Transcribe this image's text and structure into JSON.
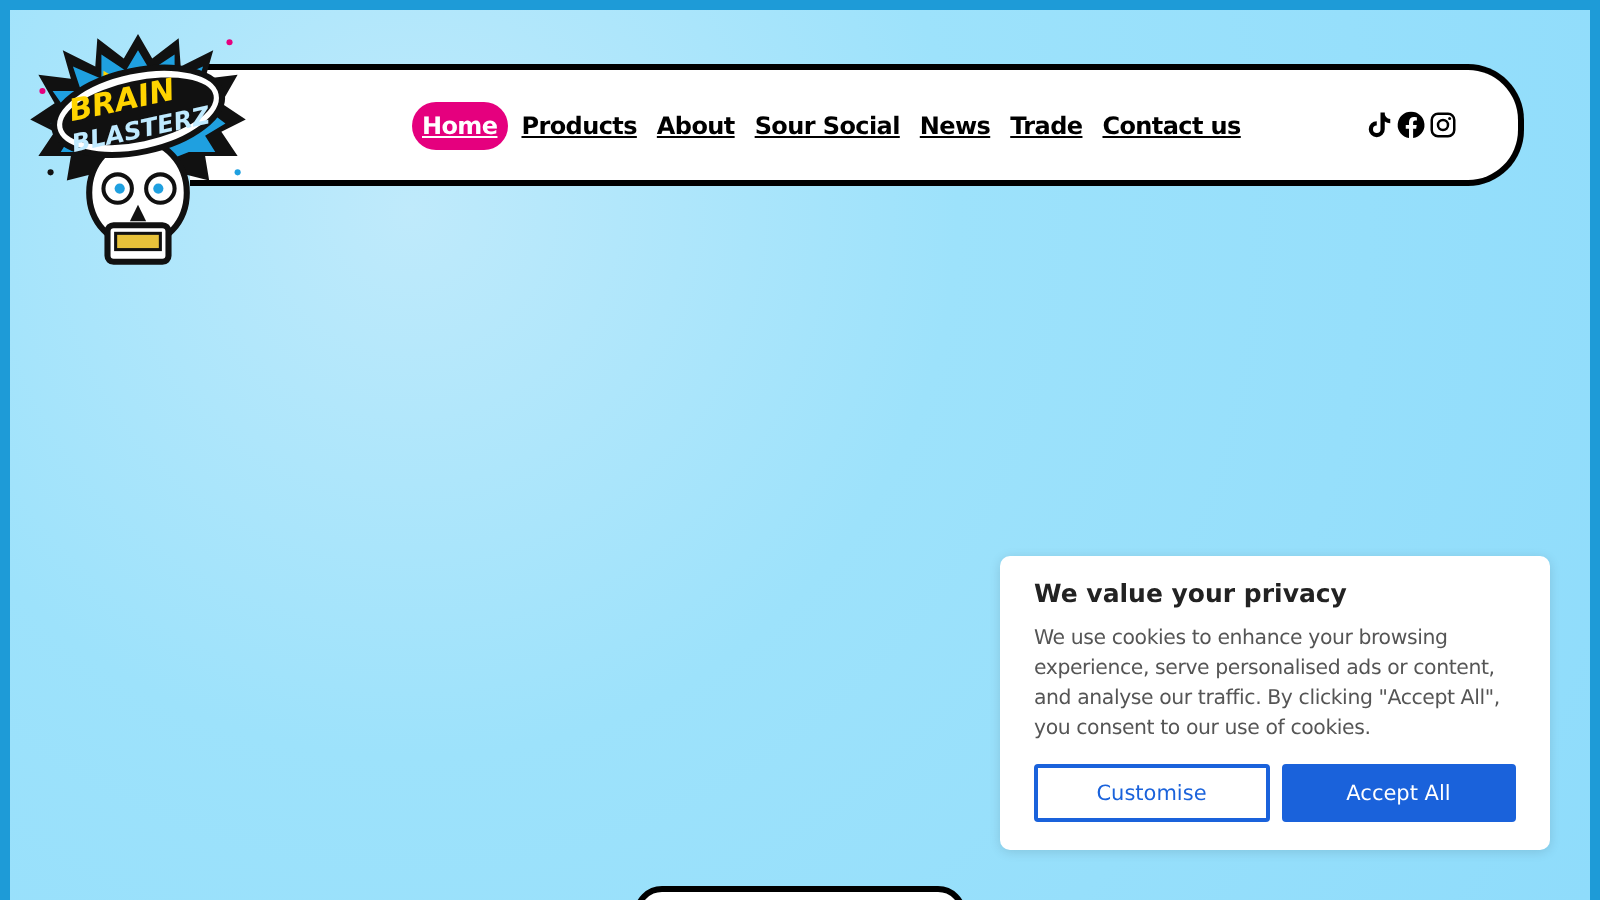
{
  "logo": {
    "line_1": "BRAIN",
    "line_2": "BLASTERZ"
  },
  "nav": [
    {
      "label": "Home",
      "selected": true
    },
    {
      "label": "Products",
      "selected": false
    },
    {
      "label": "About",
      "selected": false
    },
    {
      "label": "Sour Social",
      "selected": false
    },
    {
      "label": "News",
      "selected": false
    },
    {
      "label": "Trade",
      "selected": false
    },
    {
      "label": "Contact us",
      "selected": false
    }
  ],
  "social": [
    {
      "kind": "tiktok"
    },
    {
      "kind": "facebook"
    },
    {
      "kind": "instagram"
    }
  ],
  "cookie_banner": {
    "title": "We value your privacy",
    "text": "We use cookies to enhance your browsing experience, serve personalised ads or content, and analyse our traffic. By clicking \"Accept All\", you consent to our use of cookies.",
    "buttons": [
      {
        "label": "Customise",
        "kind": "outline"
      },
      {
        "label": "Accept All",
        "kind": "primary"
      }
    ]
  }
}
